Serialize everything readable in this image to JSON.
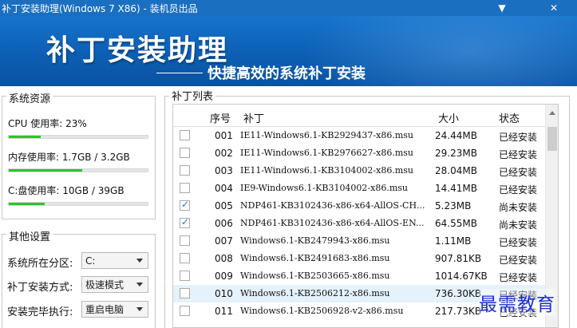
{
  "window": {
    "title": "补丁安装助理(Windows 7 X86) - 装机员出品",
    "minimize_glyph": "▼",
    "close_glyph": "✕"
  },
  "banner": {
    "title": "补丁安装助理",
    "subtitle": "快捷高效的系统补丁安装"
  },
  "resources": {
    "title": "系统资源",
    "cpu": {
      "label": "CPU 使用率: 23%",
      "percent": 23
    },
    "mem": {
      "label": "内存使用率: 1.7GB / 3.2GB",
      "percent": 53
    },
    "disk": {
      "label": "C:盘使用率: 10GB / 39GB",
      "percent": 26
    }
  },
  "settings": {
    "title": "其他设置",
    "partition": {
      "label": "系统所在分区:",
      "value": "C:"
    },
    "mode": {
      "label": "补丁安装方式:",
      "value": "极速模式"
    },
    "after": {
      "label": "安装完毕执行:",
      "value": "重启电脑"
    }
  },
  "patches": {
    "title": "补丁列表",
    "headers": {
      "num": "序号",
      "name": "补丁",
      "size": "大小",
      "status": "状态"
    },
    "rows": [
      {
        "checked": false,
        "num": "001",
        "name": "IE11-Windows6.1-KB2929437-x86.msu",
        "size": "24.44MB",
        "status": "已经安装"
      },
      {
        "checked": false,
        "num": "002",
        "name": "IE11-Windows6.1-KB2976627-x86.msu",
        "size": "29.23MB",
        "status": "已经安装"
      },
      {
        "checked": false,
        "num": "003",
        "name": "IE11-Windows6.1-KB3104002-x86.msu",
        "size": "28.04MB",
        "status": "已经安装"
      },
      {
        "checked": false,
        "num": "004",
        "name": "IE9-Windows6.1-KB3104002-x86.msu",
        "size": "14.41MB",
        "status": "已经安装"
      },
      {
        "checked": true,
        "num": "005",
        "name": "NDP461-KB3102436-x86-x64-AllOS-CH...",
        "size": "5.23MB",
        "status": "尚未安装"
      },
      {
        "checked": true,
        "num": "006",
        "name": "NDP461-KB3102436-x86-x64-AllOS-EN...",
        "size": "64.55MB",
        "status": "尚未安装"
      },
      {
        "checked": false,
        "num": "007",
        "name": "Windows6.1-KB2479943-x86.msu",
        "size": "1.11MB",
        "status": "已经安装"
      },
      {
        "checked": false,
        "num": "008",
        "name": "Windows6.1-KB2491683-x86.msu",
        "size": "907.81KB",
        "status": "已经安装"
      },
      {
        "checked": false,
        "num": "009",
        "name": "Windows6.1-KB2503665-x86.msu",
        "size": "1014.67KB",
        "status": "已经安装"
      },
      {
        "checked": false,
        "num": "010",
        "name": "Windows6.1-KB2506212-x86.msu",
        "size": "736.30KB",
        "status": "已经安装"
      },
      {
        "checked": false,
        "num": "011",
        "name": "Windows6.1-KB2506928-v2-x86.msu",
        "size": "217.73KB",
        "status": "已经安装"
      }
    ]
  },
  "watermark": "最需教育"
}
